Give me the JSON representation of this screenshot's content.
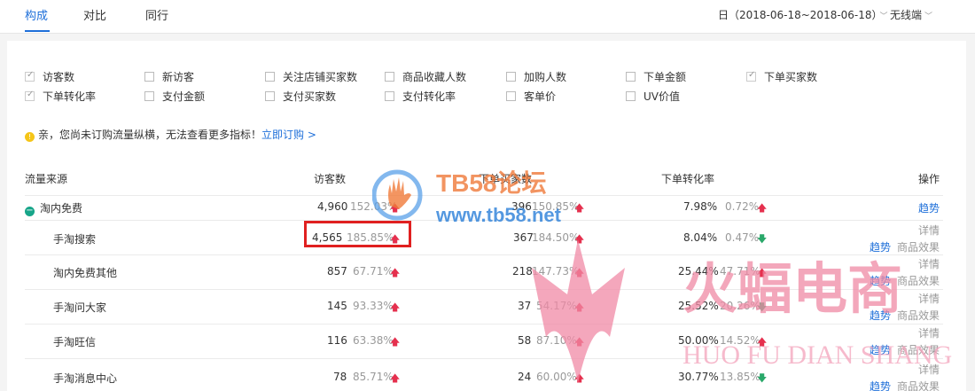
{
  "tabs": [
    {
      "label": "构成",
      "active": true
    },
    {
      "label": "对比",
      "active": false
    },
    {
      "label": "同行",
      "active": false
    }
  ],
  "date_range": "日（2018-06-18~2018-06-18）",
  "device": "无线端",
  "metrics": [
    {
      "label": "访客数",
      "checked": true
    },
    {
      "label": "新访客",
      "checked": false
    },
    {
      "label": "关注店铺买家数",
      "checked": false
    },
    {
      "label": "商品收藏人数",
      "checked": false
    },
    {
      "label": "加购人数",
      "checked": false
    },
    {
      "label": "下单金额",
      "checked": false
    },
    {
      "label": "下单买家数",
      "checked": true
    },
    {
      "label": "下单转化率",
      "checked": true
    },
    {
      "label": "支付金额",
      "checked": false
    },
    {
      "label": "支付买家数",
      "checked": false
    },
    {
      "label": "支付转化率",
      "checked": false
    },
    {
      "label": "客单价",
      "checked": false
    },
    {
      "label": "UV价值",
      "checked": false
    }
  ],
  "notice": {
    "text": "亲，您尚未订购流量纵横，无法查看更多指标！",
    "link": "立即订购 >"
  },
  "table": {
    "headers": [
      "流量来源",
      "访客数",
      "下单买家数",
      "下单转化率",
      "操作"
    ],
    "rows": [
      {
        "source": "淘内免费",
        "visitors": "4,960",
        "visitors_pct": "152.03%",
        "visitors_dir": "up",
        "buyers": "396",
        "buyers_pct": "150.85%",
        "buyers_dir": "up",
        "conv": "7.98%",
        "conv_pct": "0.72%",
        "conv_dir": "up",
        "ops": [
          "趋势"
        ]
      },
      {
        "source": "手淘搜索",
        "visitors": "4,565",
        "visitors_pct": "185.85%",
        "visitors_dir": "up",
        "buyers": "367",
        "buyers_pct": "184.50%",
        "buyers_dir": "up",
        "conv": "8.04%",
        "conv_pct": "0.47%",
        "conv_dir": "down",
        "ops": [
          "详情",
          "趋势",
          "商品效果"
        ]
      },
      {
        "source": "淘内免费其他",
        "visitors": "857",
        "visitors_pct": "67.71%",
        "visitors_dir": "up",
        "buyers": "218",
        "buyers_pct": "147.73%",
        "buyers_dir": "up",
        "conv": "25.44%",
        "conv_pct": "47.71%",
        "conv_dir": "up",
        "ops": [
          "详情",
          "趋势",
          "商品效果"
        ]
      },
      {
        "source": "手淘问大家",
        "visitors": "145",
        "visitors_pct": "93.33%",
        "visitors_dir": "up",
        "buyers": "37",
        "buyers_pct": "54.17%",
        "buyers_dir": "up",
        "conv": "25.52%",
        "conv_pct": "20.26%",
        "conv_dir": "down",
        "ops": [
          "详情",
          "趋势",
          "商品效果"
        ]
      },
      {
        "source": "手淘旺信",
        "visitors": "116",
        "visitors_pct": "63.38%",
        "visitors_dir": "up",
        "buyers": "58",
        "buyers_pct": "87.10%",
        "buyers_dir": "up",
        "conv": "50.00%",
        "conv_pct": "14.52%",
        "conv_dir": "up",
        "ops": [
          "详情",
          "趋势",
          "商品效果"
        ]
      },
      {
        "source": "手淘消息中心",
        "visitors": "78",
        "visitors_pct": "85.71%",
        "visitors_dir": "up",
        "buyers": "24",
        "buyers_pct": "60.00%",
        "buyers_dir": "up",
        "conv": "30.77%",
        "conv_pct": "13.85%",
        "conv_dir": "down",
        "ops": [
          "详情",
          "趋势",
          "商品效果"
        ]
      }
    ]
  },
  "watermarks": {
    "tb58_title": "TB58论坛",
    "tb58_url": "www.tb58.net",
    "hf_cn": "火蝠电商",
    "hf_en": "HUO FU DIAN SHANG"
  },
  "colors": {
    "accent": "#1e6fd9",
    "up": "#e5304e",
    "down": "#2aa86a",
    "highlight": "#e02020",
    "watermark_pink": "#f08aa5"
  }
}
